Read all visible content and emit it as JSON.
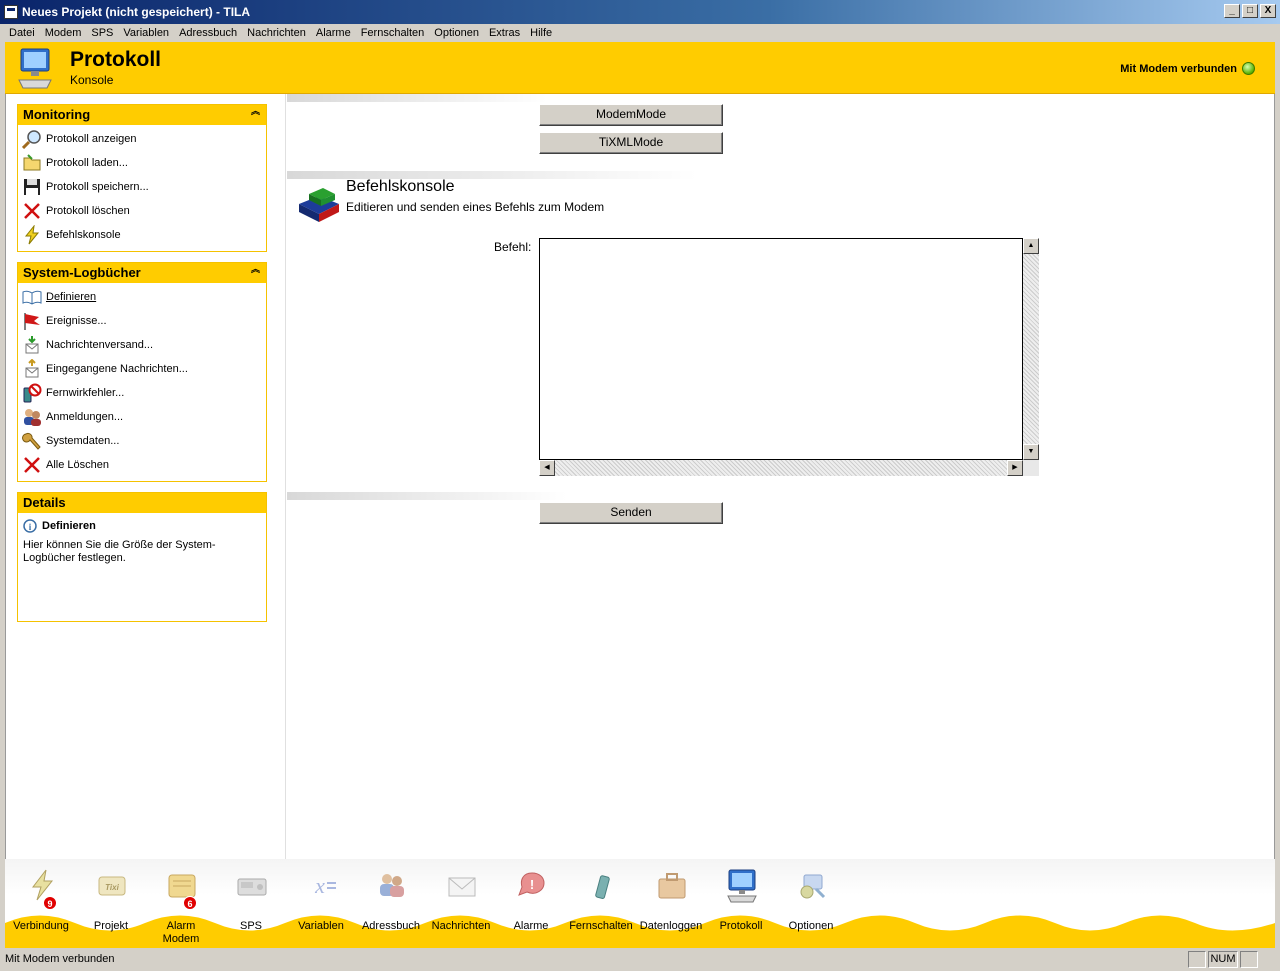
{
  "window": {
    "title": "Neues Projekt (nicht gespeichert) - TILA",
    "minimize": "_",
    "maximize": "□",
    "close": "X"
  },
  "menu": [
    "Datei",
    "Modem",
    "SPS",
    "Variablen",
    "Adressbuch",
    "Nachrichten",
    "Alarme",
    "Fernschalten",
    "Optionen",
    "Extras",
    "Hilfe"
  ],
  "header": {
    "title": "Protokoll",
    "subtitle": "Konsole",
    "connection": "Mit Modem verbunden",
    "connection_color": "#58b000",
    "accent": "#ffcc00"
  },
  "sidebar": {
    "monitoring": {
      "title": "Monitoring",
      "items": [
        {
          "label": "Protokoll anzeigen",
          "icon": "magnifier-icon"
        },
        {
          "label": "Protokoll laden...",
          "icon": "folder-open-icon"
        },
        {
          "label": "Protokoll speichern...",
          "icon": "floppy-disk-icon"
        },
        {
          "label": "Protokoll löschen",
          "icon": "delete-x-icon"
        },
        {
          "label": "Befehlskonsole",
          "icon": "lightning-icon"
        }
      ]
    },
    "logbooks": {
      "title": "System-Logbücher",
      "items": [
        {
          "label": "Definieren",
          "icon": "book-icon"
        },
        {
          "label": "Ereignisse...",
          "icon": "flag-icon"
        },
        {
          "label": "Nachrichtenversand...",
          "icon": "mail-send-icon"
        },
        {
          "label": "Eingegangene Nachrichten...",
          "icon": "mail-receive-icon"
        },
        {
          "label": "Fernwirkfehler...",
          "icon": "phone-error-icon"
        },
        {
          "label": "Anmeldungen...",
          "icon": "users-icon"
        },
        {
          "label": "Systemdaten...",
          "icon": "wrench-icon"
        },
        {
          "label": "Alle Löschen",
          "icon": "delete-x-icon"
        }
      ]
    },
    "details": {
      "title": "Details",
      "heading": "Definieren",
      "text": "Hier können Sie die Größe der System-Logbücher festlegen."
    }
  },
  "content": {
    "modem_mode_button": "ModemMode",
    "tixml_mode_button": "TiXMLMode",
    "console_title": "Befehlskonsole",
    "console_subtitle": "Editieren und senden eines Befehls zum Modem",
    "command_label": "Befehl:",
    "command_value": "",
    "send_button": "Senden"
  },
  "bottom_nav": [
    {
      "label": "Verbindung",
      "icon": "lightning-icon",
      "badge": "9"
    },
    {
      "label": "Projekt",
      "icon": "tixi-device-icon"
    },
    {
      "label": "Alarm\nModem",
      "icon": "alarm-modem-icon",
      "badge": "6"
    },
    {
      "label": "SPS",
      "icon": "plc-icon"
    },
    {
      "label": "Variablen",
      "icon": "variable-x-icon"
    },
    {
      "label": "Adressbuch",
      "icon": "address-book-icon"
    },
    {
      "label": "Nachrichten",
      "icon": "envelope-icon"
    },
    {
      "label": "Alarme",
      "icon": "alarm-icon"
    },
    {
      "label": "Fernschalten",
      "icon": "remote-switch-icon"
    },
    {
      "label": "Datenloggen",
      "icon": "briefcase-icon"
    },
    {
      "label": "Protokoll",
      "icon": "monitor-keyboard-icon",
      "active": true
    },
    {
      "label": "Optionen",
      "icon": "options-icon"
    }
  ],
  "status": {
    "text": "Mit Modem verbunden",
    "num": "NUM"
  }
}
